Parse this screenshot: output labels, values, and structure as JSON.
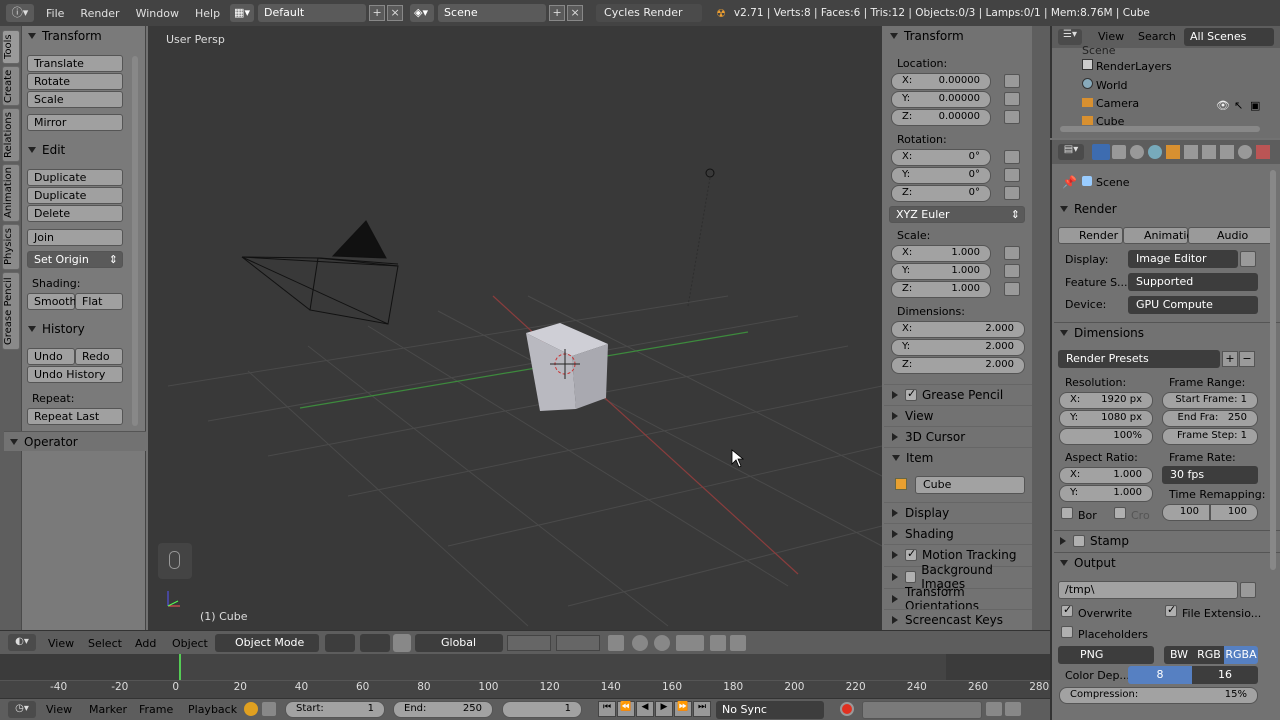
{
  "topbar": {
    "menus": [
      "File",
      "Render",
      "Window",
      "Help"
    ],
    "screen_layout": "Default",
    "scene": "Scene",
    "engine": "Cycles Render",
    "stats": "v2.71 | Verts:8 | Faces:6 | Tris:12 | Objects:0/3 | Lamps:0/1 | Mem:8.76M | Cube"
  },
  "left_tabs": [
    "Tools",
    "Create",
    "Relations",
    "Animation",
    "Physics",
    "Grease Pencil"
  ],
  "toolshelf": {
    "transform_title": "Transform",
    "translate": "Translate",
    "rotate": "Rotate",
    "scale": "Scale",
    "mirror": "Mirror",
    "edit_title": "Edit",
    "duplicate": "Duplicate",
    "duplicate_linked": "Duplicate Linked",
    "delete": "Delete",
    "join": "Join",
    "set_origin": "Set Origin",
    "shading_label": "Shading:",
    "smooth": "Smooth",
    "flat": "Flat",
    "history_title": "History",
    "undo": "Undo",
    "redo": "Redo",
    "undo_history": "Undo History",
    "repeat_label": "Repeat:",
    "repeat_last": "Repeat Last",
    "operator_title": "Operator"
  },
  "viewport": {
    "view_name": "User Persp",
    "object_label": "(1) Cube"
  },
  "npanel": {
    "transform_title": "Transform",
    "location_label": "Location:",
    "loc": [
      {
        "k": "X:",
        "v": "0.00000"
      },
      {
        "k": "Y:",
        "v": "0.00000"
      },
      {
        "k": "Z:",
        "v": "0.00000"
      }
    ],
    "rotation_label": "Rotation:",
    "rot": [
      {
        "k": "X:",
        "v": "0°"
      },
      {
        "k": "Y:",
        "v": "0°"
      },
      {
        "k": "Z:",
        "v": "0°"
      }
    ],
    "rotation_mode": "XYZ Euler",
    "scale_label": "Scale:",
    "scl": [
      {
        "k": "X:",
        "v": "1.000"
      },
      {
        "k": "Y:",
        "v": "1.000"
      },
      {
        "k": "Z:",
        "v": "1.000"
      }
    ],
    "dimensions_label": "Dimensions:",
    "dim": [
      {
        "k": "X:",
        "v": "2.000"
      },
      {
        "k": "Y:",
        "v": "2.000"
      },
      {
        "k": "Z:",
        "v": "2.000"
      }
    ],
    "grease_pencil": "Grease Pencil",
    "view": "View",
    "cursor_3d": "3D Cursor",
    "item": "Item",
    "item_name": "Cube",
    "display": "Display",
    "shading": "Shading",
    "motion_tracking": "Motion Tracking",
    "background_images": "Background Images",
    "transform_orientations": "Transform Orientations",
    "screencast_keys": "Screencast Keys"
  },
  "outliner": {
    "view": "View",
    "search": "Search",
    "filter": "All Scenes",
    "items": [
      "Scene",
      "RenderLayers",
      "World",
      "Camera",
      "Cube"
    ]
  },
  "props": {
    "scene": "Scene",
    "render_title": "Render",
    "render_btn": "Render",
    "animation_btn": "Animation",
    "audio_btn": "Audio",
    "display_label": "Display:",
    "display_val": "Image Editor",
    "feature_label": "Feature S...",
    "feature_val": "Supported",
    "device_label": "Device:",
    "device_val": "GPU Compute",
    "dimensions_title": "Dimensions",
    "render_presets": "Render Presets",
    "resolution_label": "Resolution:",
    "res_x": "1920 px",
    "res_y": "1080 px",
    "res_pct": "100%",
    "frame_range_label": "Frame Range:",
    "start_frame": "Start Frame: 1",
    "end_frame": "End Fra:   250",
    "frame_step": "Frame Step: 1",
    "aspect_label": "Aspect Ratio:",
    "asp_x": "1.000",
    "asp_y": "1.000",
    "frame_rate_label": "Frame Rate:",
    "frame_rate": "30 fps",
    "time_remap_label": "Time Remapping:",
    "remap_old": "100",
    "remap_new": "100",
    "bor": "Bor",
    "cro": "Cro",
    "stamp_title": "Stamp",
    "output_title": "Output",
    "output_path": "/tmp\\",
    "overwrite": "Overwrite",
    "file_ext": "File Extensio...",
    "placeholders": "Placeholders",
    "format": "PNG",
    "bw": "BW",
    "rgb": "RGB",
    "rgba": "RGBA",
    "color_depth_label": "Color Dep...",
    "depth_8": "8",
    "depth_16": "16",
    "compression": "Compression:",
    "compression_val": "15%"
  },
  "header3d": {
    "view": "View",
    "select": "Select",
    "add": "Add",
    "object": "Object",
    "mode": "Object Mode",
    "orientation": "Global"
  },
  "timeline": {
    "ticks": [
      "-40",
      "-20",
      "0",
      "20",
      "40",
      "60",
      "80",
      "100",
      "120",
      "140",
      "160",
      "180",
      "200",
      "220",
      "240",
      "260",
      "280"
    ]
  },
  "tlhdr": {
    "view": "View",
    "marker": "Marker",
    "frame": "Frame",
    "playback": "Playback",
    "start": "Start:",
    "start_val": "1",
    "end": "End:",
    "end_val": "250",
    "current": "1",
    "sync": "No Sync"
  }
}
